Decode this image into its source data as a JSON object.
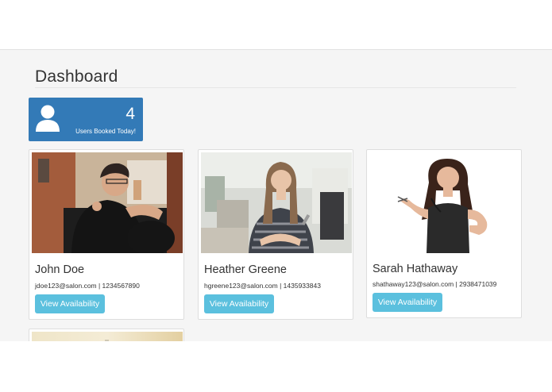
{
  "dashboard": {
    "title": "Dashboard"
  },
  "stat_panel": {
    "count": "4",
    "label": "Users Booked Today!",
    "icon": "user-icon",
    "color": "#337ab7"
  },
  "stylists": [
    {
      "name": "John Doe",
      "contact": "jdoe123@salon.com | 1234567890",
      "button": "View Availability"
    },
    {
      "name": "Heather Greene",
      "contact": "hgreene123@salon.com | 1435933843",
      "button": "View Availability"
    },
    {
      "name": "Sarah Hathaway",
      "contact": "shathaway123@salon.com | 2938471039",
      "button": "View Availability"
    }
  ],
  "colors": {
    "primary": "#337ab7",
    "button": "#5bc0de",
    "background": "#f5f5f5"
  }
}
